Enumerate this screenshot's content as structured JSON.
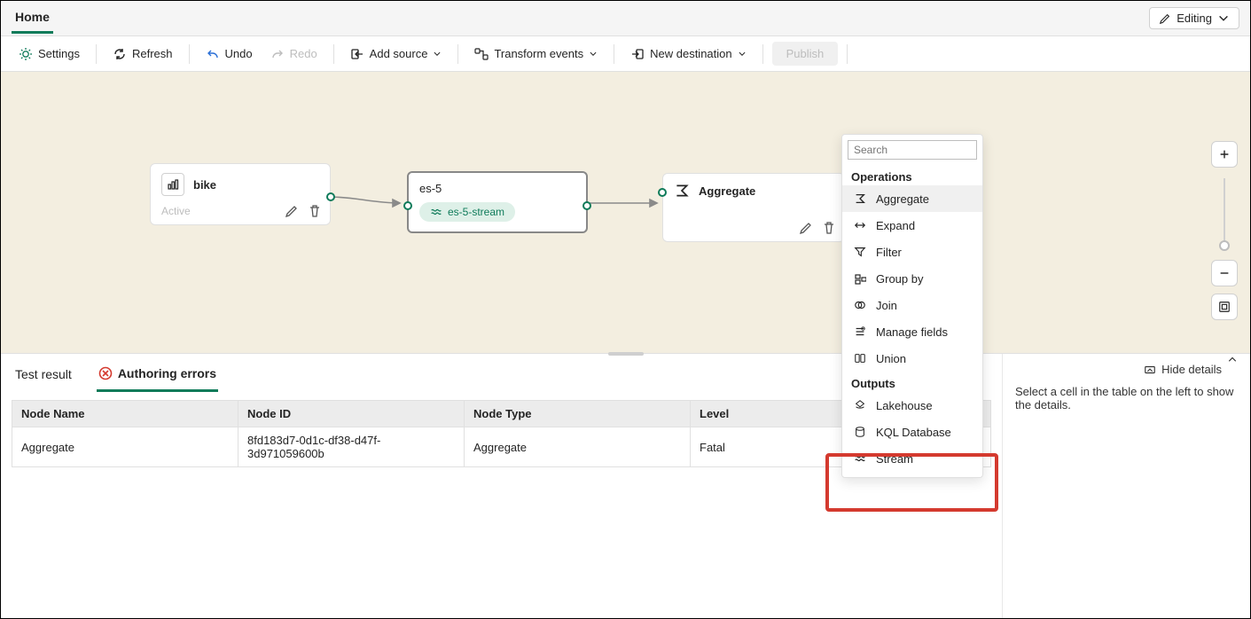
{
  "header": {
    "home": "Home",
    "editing": "Editing"
  },
  "toolbar": {
    "settings": "Settings",
    "refresh": "Refresh",
    "undo": "Undo",
    "redo": "Redo",
    "add_source": "Add source",
    "transform_events": "Transform events",
    "new_destination": "New destination",
    "publish": "Publish"
  },
  "canvas": {
    "nodes": {
      "source": {
        "title": "bike",
        "status": "Active"
      },
      "stream": {
        "title": "es-5",
        "chip": "es-5-stream"
      },
      "aggregate": {
        "title": "Aggregate"
      }
    }
  },
  "dropdown": {
    "search_placeholder": "Search",
    "section_ops": "Operations",
    "section_outputs": "Outputs",
    "ops": [
      "Aggregate",
      "Expand",
      "Filter",
      "Group by",
      "Join",
      "Manage fields",
      "Union"
    ],
    "outputs": [
      "Lakehouse",
      "KQL Database",
      "Stream"
    ]
  },
  "bottom": {
    "tab_test": "Test result",
    "tab_errors": "Authoring errors",
    "hide_details": "Hide details",
    "columns": {
      "name": "Node Name",
      "id": "Node ID",
      "type": "Node Type",
      "level": "Level"
    },
    "rows": [
      {
        "name": "Aggregate",
        "id": "8fd183d7-0d1c-df38-d47f-3d971059600b",
        "type": "Aggregate",
        "level": "Fatal"
      }
    ],
    "details_hint": "Select a cell in the table on the left to show the details."
  }
}
